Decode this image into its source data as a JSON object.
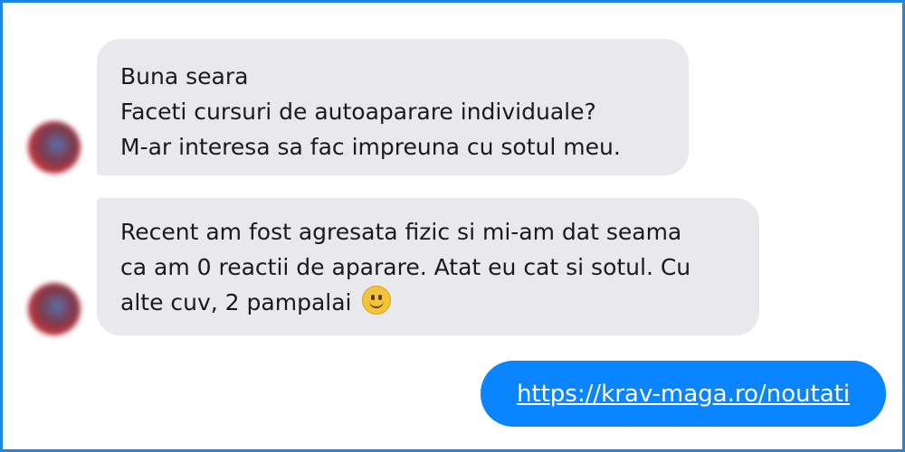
{
  "conversation": {
    "messages": [
      {
        "direction": "incoming",
        "lines": [
          "Buna seara",
          "Faceti cursuri de autoaparare individuale?",
          "M-ar interesa sa fac impreuna cu sotul meu."
        ]
      },
      {
        "direction": "incoming",
        "lines": [
          "Recent am fost agresata fizic si mi-am dat seama",
          "ca am 0 reactii de aparare. Atat eu cat si sotul. Cu",
          "alte cuv, 2 pampalai"
        ],
        "emoji": "slightly-smiling-face-icon"
      },
      {
        "direction": "outgoing",
        "link_text": "https://krav-maga.ro/noutati"
      }
    ]
  },
  "colors": {
    "frame_border": "#1c86e6",
    "incoming_bubble": "#e9e9ed",
    "outgoing_bubble": "#0b84ff"
  }
}
